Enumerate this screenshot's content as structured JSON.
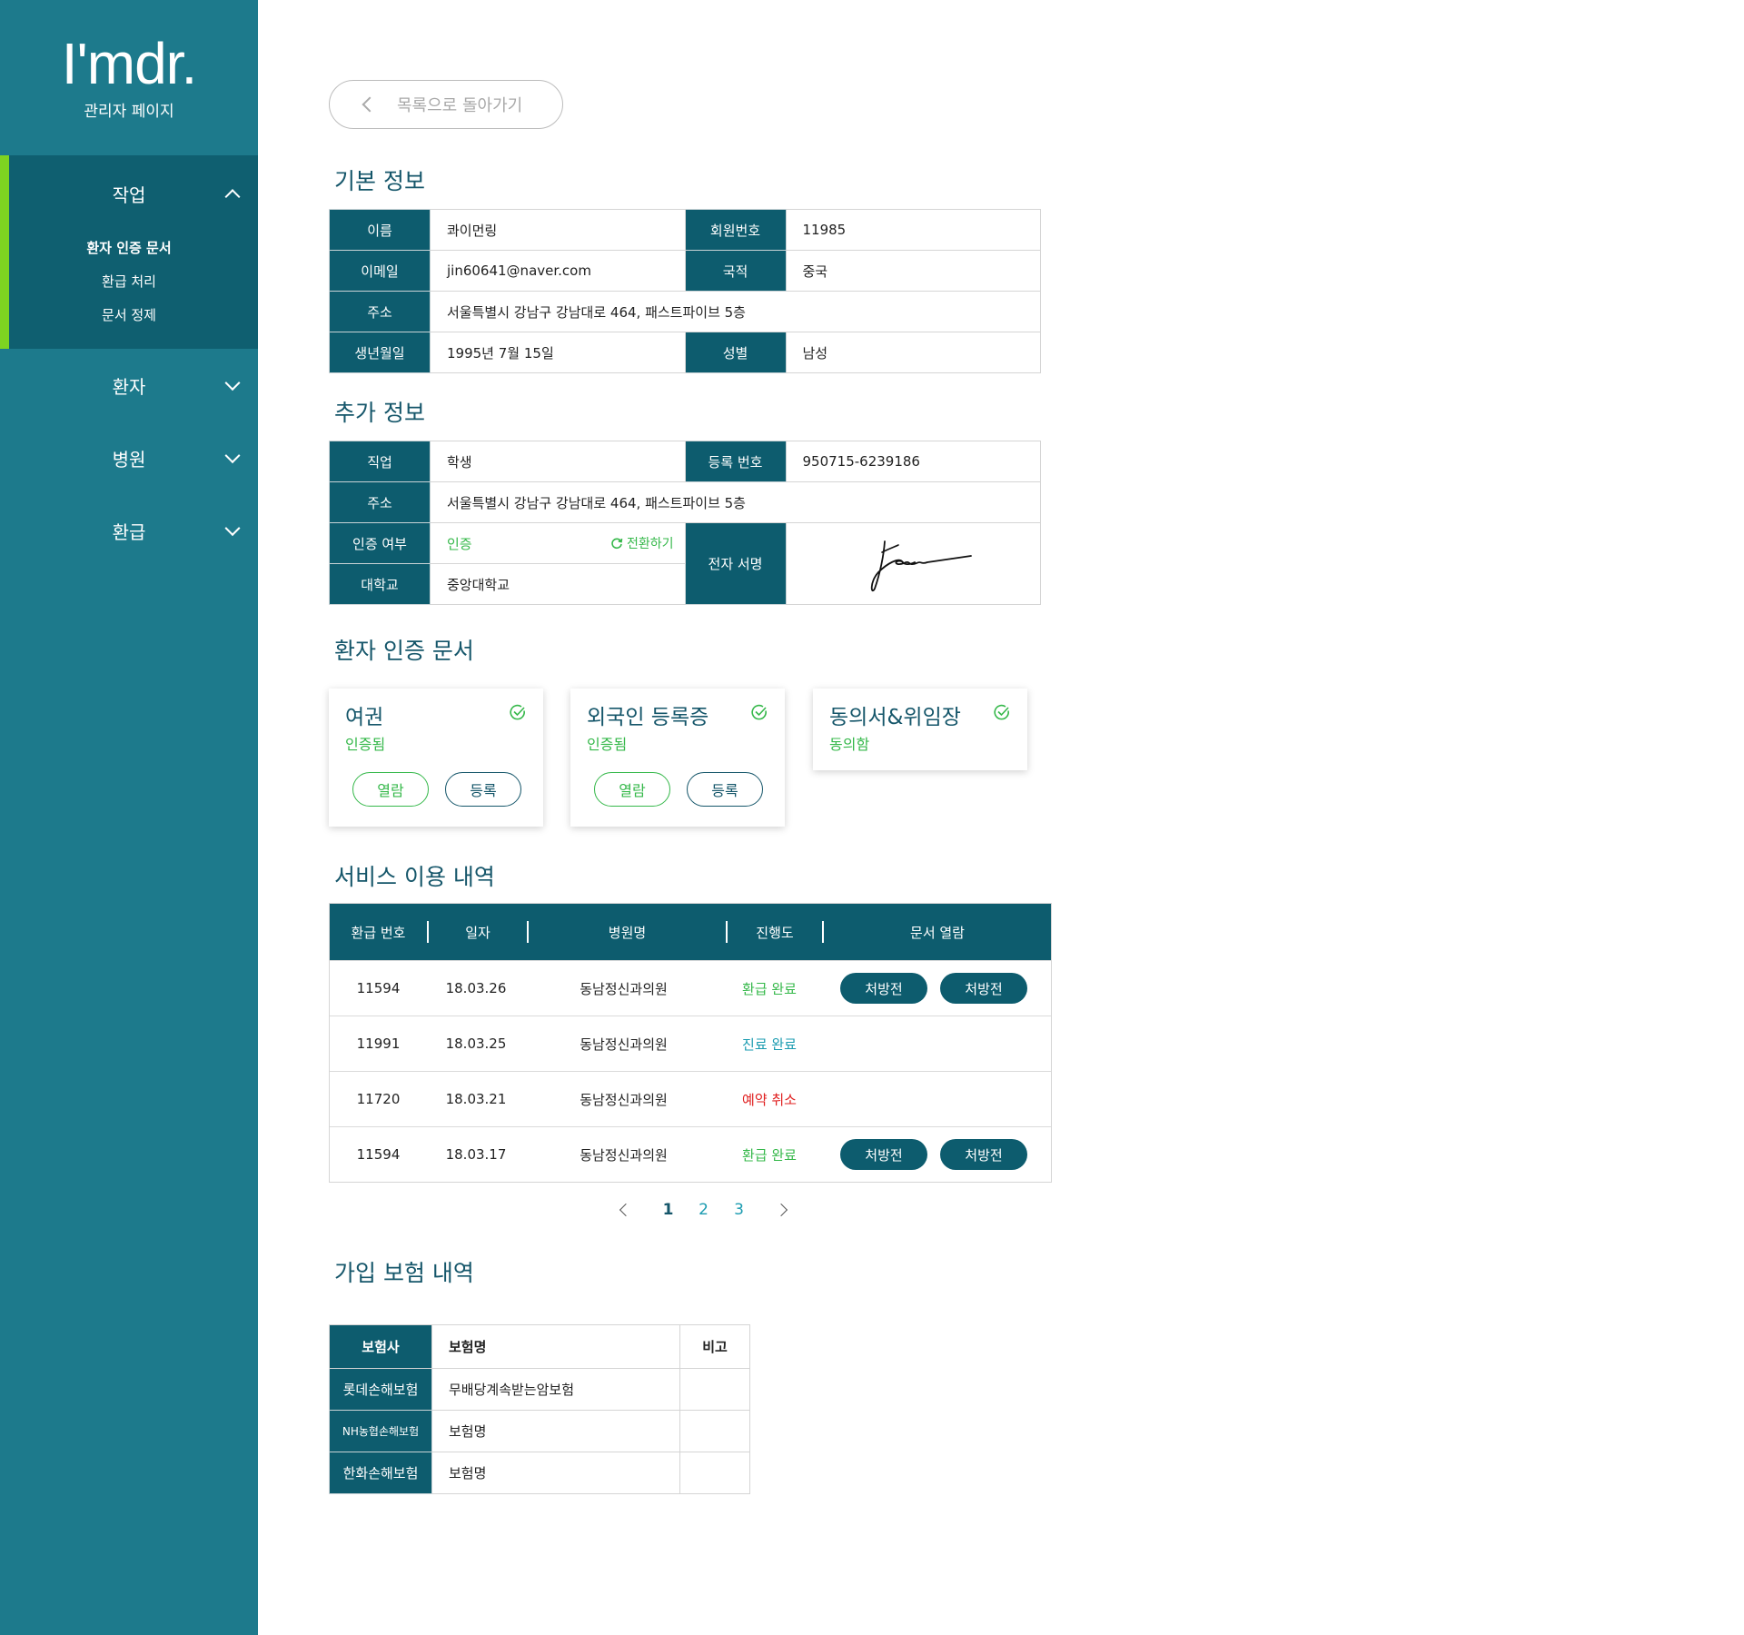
{
  "sidebar": {
    "logo": "I'mdr.",
    "subtitle": "관리자 페이지",
    "groups": [
      {
        "label": "작업",
        "items": [
          "환자 인증 문서",
          "환급 처리",
          "문서 정제"
        ]
      },
      {
        "label": "환자"
      },
      {
        "label": "병원"
      },
      {
        "label": "환급"
      }
    ]
  },
  "back_button": "목록으로 돌아가기",
  "basic": {
    "title": "기본 정보",
    "name_label": "이름",
    "name": "콰이먼링",
    "member_label": "회원번호",
    "member": "11985",
    "email_label": "이메일",
    "email": "jin60641@naver.com",
    "country_label": "국적",
    "country": "중국",
    "address_label": "주소",
    "address": "서울특별시 강남구 강남대로 464, 패스트파이브 5층",
    "birth_label": "생년월일",
    "birth": "1995년 7월 15일",
    "gender_label": "성별",
    "gender": "남성"
  },
  "extra": {
    "title": "추가 정보",
    "job_label": "직업",
    "job": "학생",
    "reg_label": "등록 번호",
    "reg": "950715-6239186",
    "address_label": "주소",
    "address": "서울특별시 강남구 강남대로 464, 패스트파이브 5층",
    "verify_label": "인증 여부",
    "verify": "인증",
    "toggle": "전환하기",
    "univ_label": "대학교",
    "univ": "중앙대학교",
    "sign_label": "전자 서명"
  },
  "docs": {
    "title": "환자 인증 문서",
    "cards": [
      {
        "title": "여권",
        "status": "인증됨",
        "view": "열람",
        "register": "등록"
      },
      {
        "title": "외국인 등록증",
        "status": "인증됨",
        "view": "열람",
        "register": "등록"
      },
      {
        "title": "동의서&위임장",
        "status": "동의함"
      }
    ]
  },
  "service": {
    "title": "서비스 이용 내역",
    "headers": [
      "환급 번호",
      "일자",
      "병원명",
      "진행도",
      "문서 열람"
    ],
    "rows": [
      {
        "no": "11594",
        "date": "18.03.26",
        "hospital": "동남정신과의원",
        "status": "환급 완료",
        "doc1": "처방전",
        "doc2": "처방전"
      },
      {
        "no": "11991",
        "date": "18.03.25",
        "hospital": "동남정신과의원",
        "status": "진료 완료"
      },
      {
        "no": "11720",
        "date": "18.03.21",
        "hospital": "동남정신과의원",
        "status": "예약 취소"
      },
      {
        "no": "11594",
        "date": "18.03.17",
        "hospital": "동남정신과의원",
        "status": "환급 완료",
        "doc1": "처방전",
        "doc2": "처방전"
      }
    ],
    "pages": [
      "1",
      "2",
      "3"
    ]
  },
  "insurance": {
    "title": "가입 보험 내역",
    "headers": [
      "보험사",
      "보험명",
      "비고"
    ],
    "rows": [
      {
        "company": "롯데손해보험",
        "name": "무배당계속받는암보험",
        "note": ""
      },
      {
        "company": "NH농협손해보험",
        "name": "보험명",
        "note": ""
      },
      {
        "company": "한화손해보험",
        "name": "보험명",
        "note": ""
      }
    ]
  },
  "colors": {
    "teal": "#1d7a8c",
    "dark_teal": "#0d5c6e",
    "green": "#35b84a",
    "accent_bar": "#7ed321",
    "cancel": "#e02020"
  }
}
